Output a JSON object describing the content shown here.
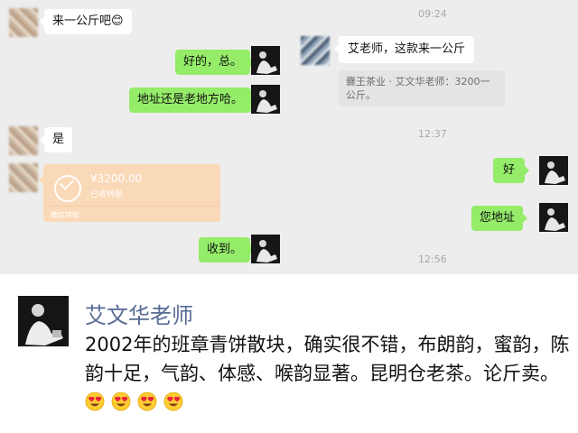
{
  "chat": {
    "timestamps": [
      "09:24",
      "12:37",
      "12:56"
    ],
    "messages": {
      "m1": "来一公斤吧😊",
      "m2": "艾老师，这款来一公斤",
      "m2_quote": "爨王茶业 · 艾文华老师：3200一公斤。",
      "m3": "好的，总。",
      "m4": "地址还是老地方哈。",
      "m5": "是",
      "m6": "好",
      "m7": "您地址",
      "m8": "收到。"
    },
    "payment": {
      "amount": "¥3200.00",
      "status": "已收转账",
      "footer": "微信转账"
    }
  },
  "post": {
    "author": "艾文华老师",
    "text": "2002年的班章青饼散块，确实很不错，布朗韵，蜜韵，陈韵十足，气韵、体感、喉韵显著。昆明仓老茶。论斤卖。",
    "emoji_count": 4,
    "emoji_icon": "heart-eyes-emoji"
  }
}
